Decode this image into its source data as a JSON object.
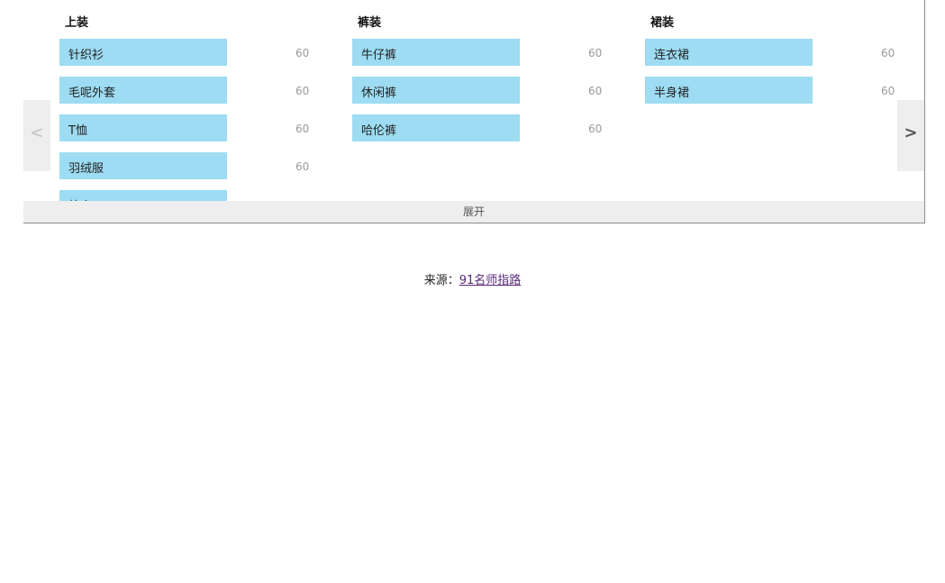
{
  "columns": [
    {
      "title": "上装",
      "items": [
        {
          "label": "针织衫",
          "count": "60"
        },
        {
          "label": "毛呢外套",
          "count": "60"
        },
        {
          "label": "T恤",
          "count": "60"
        },
        {
          "label": "羽绒服",
          "count": "60"
        },
        {
          "label": "棉衣",
          "count": ""
        }
      ]
    },
    {
      "title": "裤装",
      "items": [
        {
          "label": "牛仔裤",
          "count": "60"
        },
        {
          "label": "休闲裤",
          "count": "60"
        },
        {
          "label": "哈伦裤",
          "count": "60"
        }
      ]
    },
    {
      "title": "裙装",
      "items": [
        {
          "label": "连衣裙",
          "count": "60"
        },
        {
          "label": "半身裙",
          "count": "60"
        }
      ]
    }
  ],
  "nav": {
    "prev": "<",
    "next": ">"
  },
  "expand_label": "展开",
  "source": {
    "prefix": "来源：",
    "link_text": "91名师指路"
  },
  "colors": {
    "chip": "#9ddcf2",
    "nav_bg": "#eeeeee",
    "link": "#5a2a7a"
  }
}
